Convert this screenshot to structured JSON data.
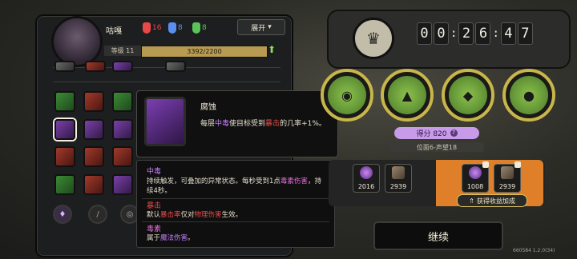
{
  "character": {
    "name": "咕嘎",
    "resources": [
      {
        "icon": "red-mask-icon",
        "value": "16",
        "color": "#e84848"
      },
      {
        "icon": "blue-mask-icon",
        "value": "8",
        "color": "#5a8ef0"
      },
      {
        "icon": "green-mask-icon",
        "value": "8",
        "color": "#5ac45a"
      }
    ],
    "expand_label": "展开",
    "level_label": "等级 11",
    "exp_text": "3392/2200",
    "exp_fraction": 1.0
  },
  "tooltip": {
    "title": "腐蚀",
    "desc_parts": [
      "每层",
      "中毒",
      "使目标受到",
      "暴击",
      "的几率+1%。"
    ]
  },
  "keywords": [
    {
      "title": "中毒",
      "title_color": "#c880ff",
      "line1": [
        "持续触发，可叠加的异常状态。每秒受到1点",
        "毒素伤害",
        "，持"
      ],
      "line2": "续4秒。"
    },
    {
      "title": "暴击",
      "title_color": "#ec4a4a",
      "line1": [
        "默认",
        "暴击率",
        "仅对",
        "物理伤害",
        "生效。"
      ]
    },
    {
      "title": "毒素",
      "title_color": "#e86ee0",
      "line1": [
        "属于",
        "魔法伤害",
        "。"
      ]
    }
  ],
  "timer": {
    "digits": [
      "0",
      "0",
      "2",
      "6",
      "4",
      "7"
    ]
  },
  "score": {
    "label": "得分 820"
  },
  "rank": {
    "label": "位面6-声望18"
  },
  "rewards": [
    {
      "icon": "purple-orb-icon",
      "value": "2016"
    },
    {
      "icon": "brown-crystal-icon",
      "value": "2939"
    }
  ],
  "bonus_rewards": [
    {
      "icon": "purple-orb-icon",
      "value": "1008"
    },
    {
      "icon": "brown-crystal-icon",
      "value": "2939"
    }
  ],
  "bonus_button": "获得收益加成",
  "continue_label": "继续",
  "version": "660584 1.2.0(34)"
}
